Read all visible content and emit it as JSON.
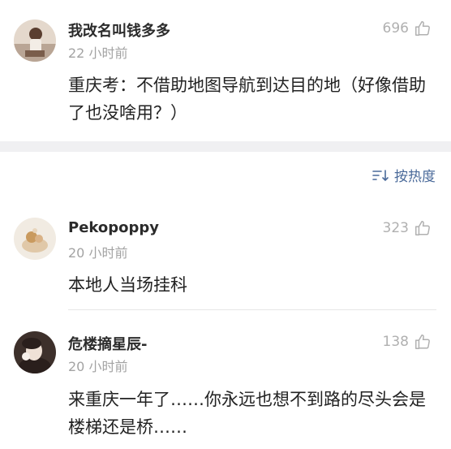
{
  "comments": [
    {
      "username": "我改名叫钱多多",
      "time": "22 小时前",
      "likes": "696",
      "text": "重庆考：不借助地图导航到达目的地（好像借助了也没啥用？）",
      "avatar_colors": [
        "#d7c9bd",
        "#6b4b3b"
      ]
    },
    {
      "username": "Pekopoppy",
      "time": "20 小时前",
      "likes": "323",
      "text": "本地人当场挂科",
      "avatar_colors": [
        "#efe6d8",
        "#c89a62"
      ]
    },
    {
      "username": "危楼摘星辰-",
      "time": "20 小时前",
      "likes": "138",
      "text": "来重庆一年了……你永远也想不到路的尽头会是楼梯还是桥……",
      "avatar_colors": [
        "#4a3a35",
        "#e9d6cb"
      ]
    }
  ],
  "sort": {
    "label": "按热度",
    "icon": "sort-icon"
  },
  "colors": {
    "section_gap": "#f0f0f2",
    "sort_accent": "#4a6a9a",
    "meta_gray": "#a3a3a3"
  }
}
